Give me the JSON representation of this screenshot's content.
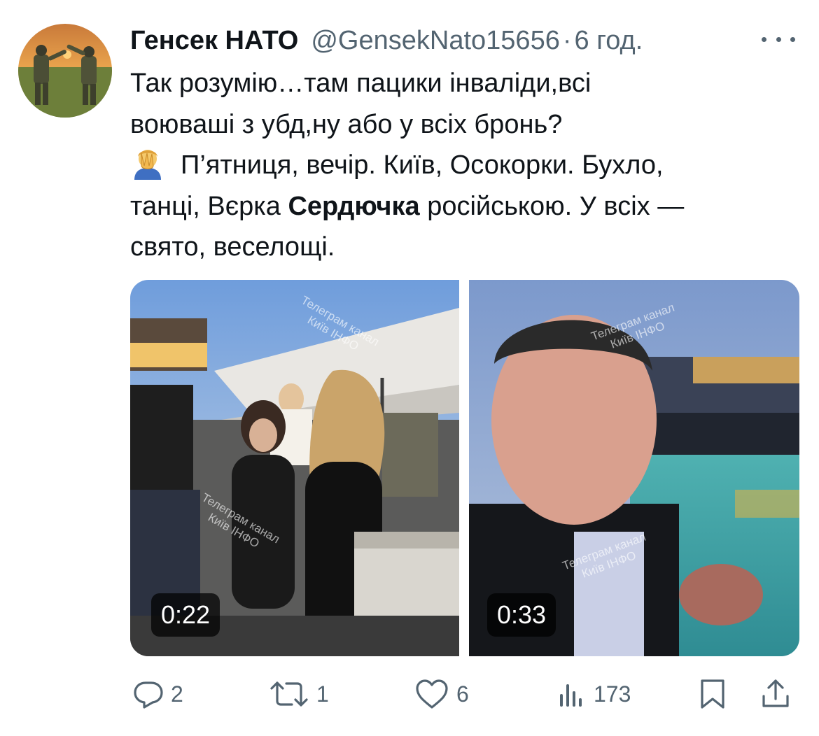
{
  "author": {
    "display_name": "Генсек НАТО",
    "handle": "@GensekNato15656",
    "separator": "·",
    "time": "6 год."
  },
  "tweet": {
    "line1": "Так розумію…там пацики інваліди,всі",
    "line2": "воюваші з убд,ну або у всіх бронь?",
    "line3": "П’ятниця, вечір. Київ, Осокорки. Бухло,",
    "line4_before": "танці, Вєрка ",
    "line4_bold": "Сердючка",
    "line4_after": " російською. У всіх —",
    "line5": "свято, веселощі.",
    "emoji": "facepalm-emoji"
  },
  "media": {
    "video1": {
      "duration": "0:22",
      "watermark_a_line1": "Телеграм канал",
      "watermark_a_line2": "Київ ІНФО",
      "watermark_b_line1": "Телеграм канал",
      "watermark_b_line2": "Київ ІНФО"
    },
    "video2": {
      "duration": "0:33",
      "watermark_a_line1": "Телеграм канал",
      "watermark_a_line2": "Київ ІНФО",
      "watermark_b_line1": "Телеграм канал",
      "watermark_b_line2": "Київ ІНФО"
    }
  },
  "actions": {
    "replies": "2",
    "retweets": "1",
    "likes": "6",
    "views": "173",
    "icons": [
      "reply-icon",
      "retweet-icon",
      "like-icon",
      "views-icon",
      "bookmark-icon",
      "share-icon"
    ]
  },
  "colors": {
    "text": "#0f1419",
    "secondary": "#536471",
    "background": "#ffffff"
  }
}
